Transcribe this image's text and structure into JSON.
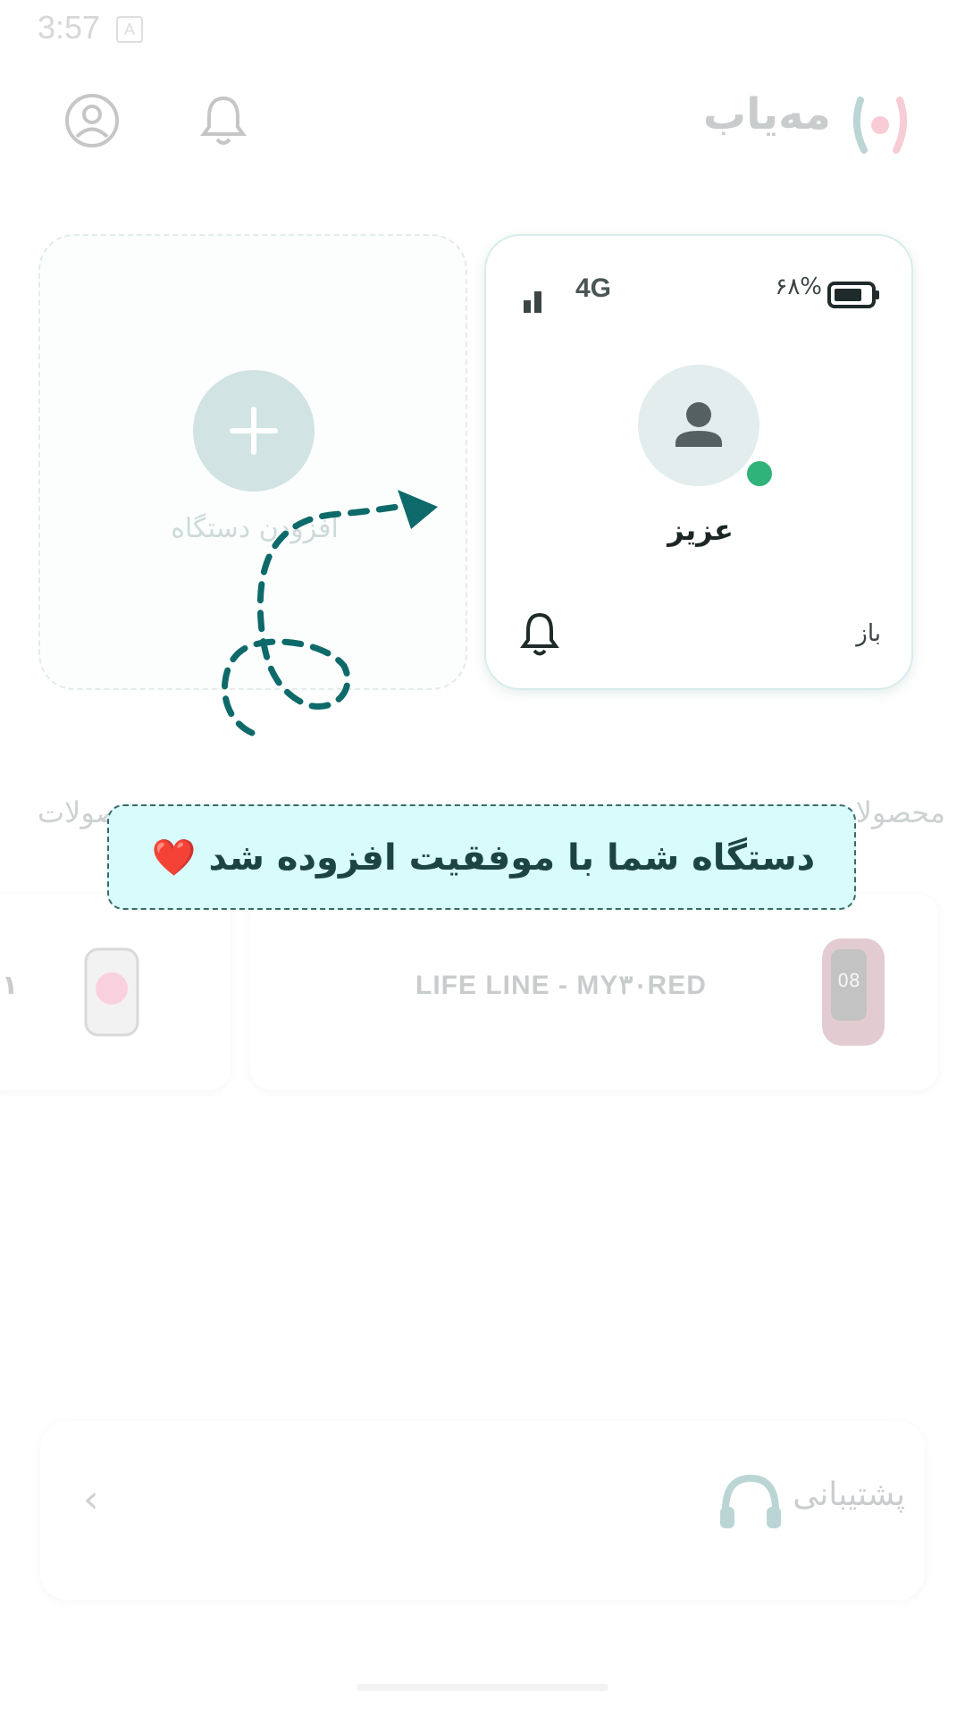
{
  "status_bar": {
    "time": "3:57",
    "a_icon": "A"
  },
  "app_bar": {
    "brand_name": "مه‌یاب",
    "icons": [
      "profile-icon",
      "bell-icon",
      "brand-logo"
    ]
  },
  "add_device": {
    "label": "افزودن دستگاه"
  },
  "device": {
    "network": "4G",
    "battery": "۶۸%",
    "name": "عزیز",
    "status": "باز"
  },
  "products": {
    "title_right": "محصولات",
    "title_left": "محصولات",
    "items": [
      {
        "name": "LIFE LINE - MY۳۰RED"
      },
      {
        "name": "۱"
      }
    ]
  },
  "support": {
    "label": "پشتیبانی"
  },
  "toast": {
    "message": "دستگاه شما با موفقیت افزوده شد ❤️"
  },
  "colors": {
    "accent": "#0e6a6a",
    "toast_bg": "#d8fbfb",
    "online": "#2fb37a"
  }
}
